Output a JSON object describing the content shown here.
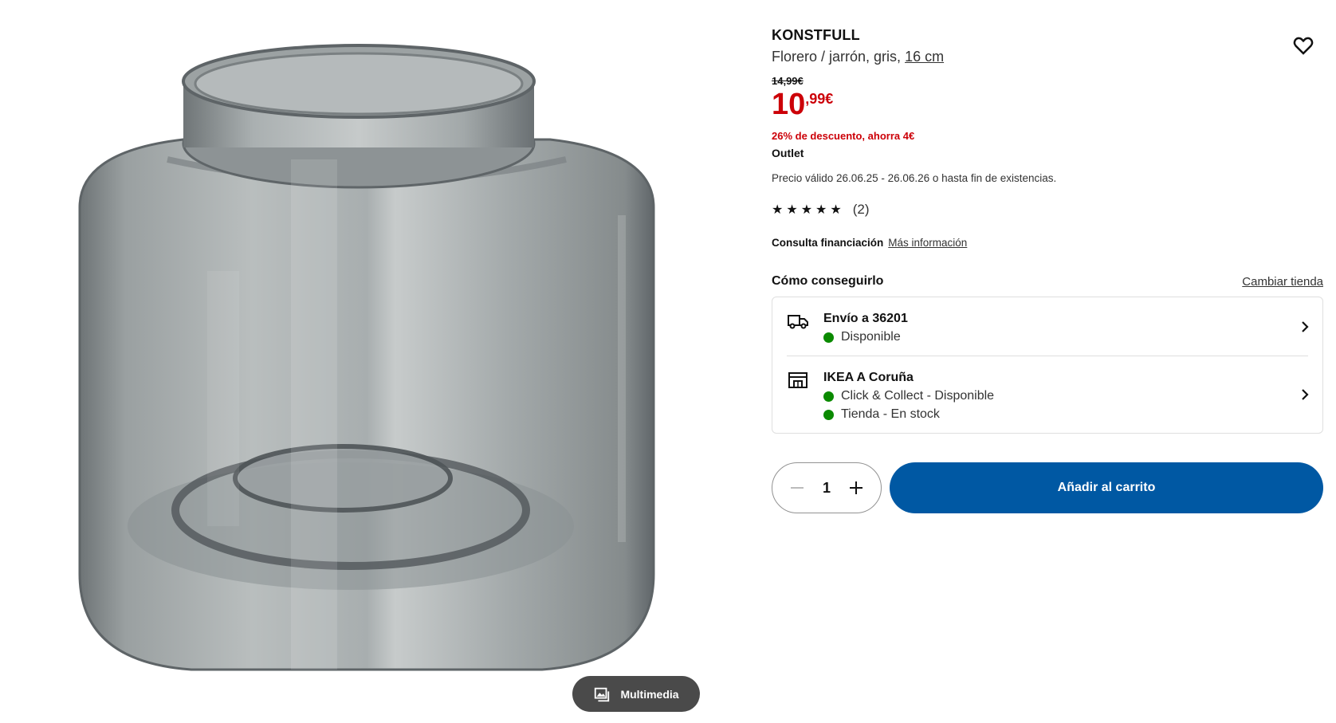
{
  "product": {
    "brand": "KONSTFULL",
    "description": "Florero / jarrón, gris,",
    "size_link": "16 cm",
    "old_price": "14,99€",
    "price_integer": "10",
    "price_decimal": ",99€",
    "discount": "26% de descuento, ahorra 4€",
    "outlet": "Outlet",
    "validity": "Precio válido 26.06.25 - 26.06.26 o hasta fin de existencias.",
    "rating_stars": 5,
    "rating_count": "(2)"
  },
  "finance": {
    "label": "Consulta financiación",
    "link": "Más información"
  },
  "get_it": {
    "title": "Cómo conseguirlo",
    "change_store": "Cambiar tienda",
    "delivery": {
      "head": "Envío a 36201",
      "status": "Disponible"
    },
    "store": {
      "head": "IKEA A Coruña",
      "click_collect": "Click & Collect - Disponible",
      "in_store": "Tienda - En stock"
    }
  },
  "cart": {
    "quantity": "1",
    "add_label": "Añadir al carrito"
  },
  "media": {
    "button_label": "Multimedia"
  },
  "colors": {
    "price_red": "#cc0008",
    "brand_blue": "#0058a3",
    "available_green": "#0a8a00"
  }
}
